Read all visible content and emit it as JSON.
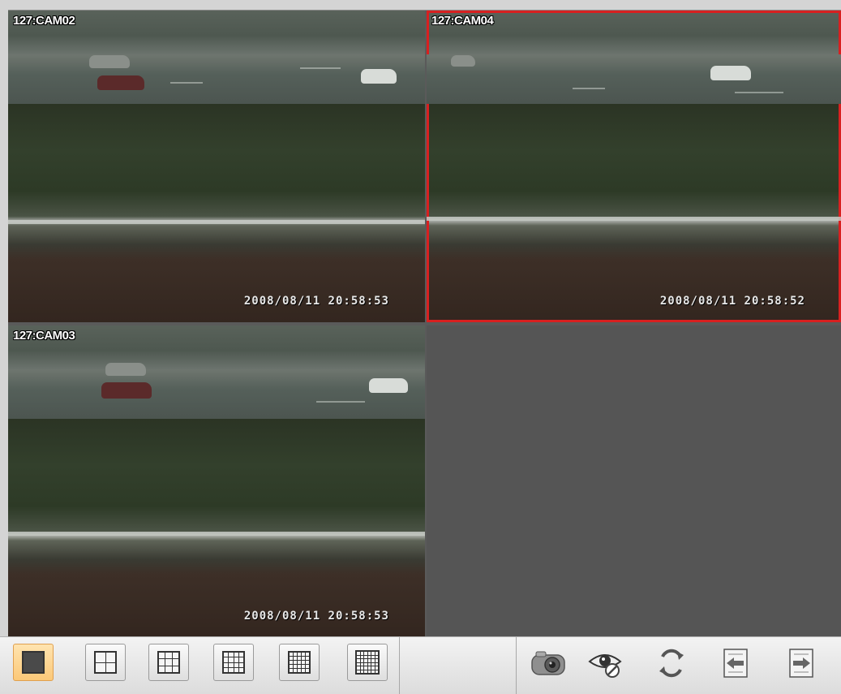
{
  "panes": [
    {
      "label": "127:CAM02",
      "timestamp": "2008/08/11 20:58:53"
    },
    {
      "label": "127:CAM04",
      "timestamp": "2008/08/11 20:58:52"
    },
    {
      "label": "127:CAM03",
      "timestamp": "2008/08/11 20:58:53"
    }
  ],
  "selected_pane": "127:CAM04",
  "colors": {
    "selection": "#d82020",
    "active_layout": "#fbc878",
    "empty_pane": "#555555"
  },
  "toolbar": {
    "layouts": [
      "1x1",
      "2x2",
      "3x3",
      "4x4",
      "5x5",
      "6x6"
    ],
    "active_layout": "1x1",
    "tools": [
      "camera-snapshot-icon",
      "eye-hide-icon",
      "refresh-cycle-icon",
      "previous-page-icon",
      "next-page-icon"
    ]
  }
}
